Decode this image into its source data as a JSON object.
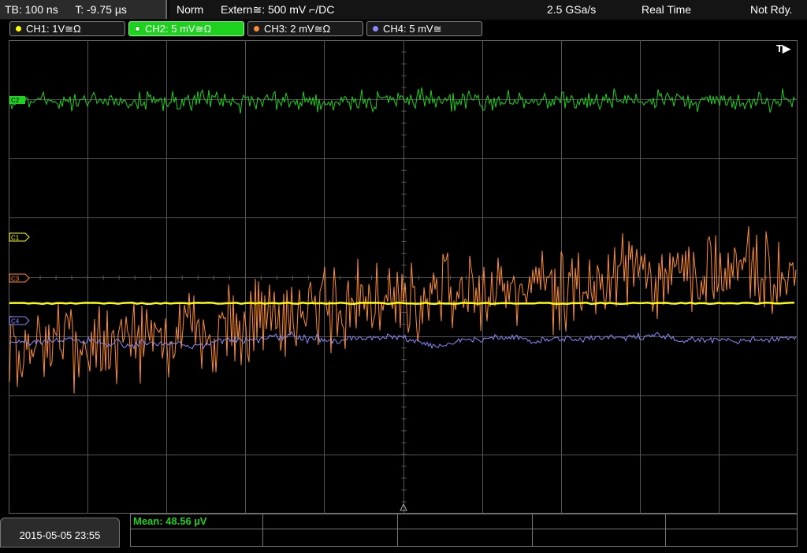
{
  "topbar": {
    "timebase": "TB: 100 ns",
    "trigger_time": "T: -9.75 µs",
    "mode": "Norm",
    "trigger": "Extern≅: 500 mV ⌐/DC",
    "sample_rate": "2.5 GSa/s",
    "acq_mode": "Real Time",
    "status": "Not Rdy."
  },
  "channels": [
    {
      "label": "CH1: 1V≅Ω",
      "color": "#ffff00"
    },
    {
      "label": "CH2: 5 mV≅Ω",
      "color": "#1fd11f"
    },
    {
      "label": "CH3: 2 mV≅Ω",
      "color": "#ff8c2e"
    },
    {
      "label": "CH4: 5 mV≅",
      "color": "#8a8aff"
    }
  ],
  "markers": {
    "ch2": "C2",
    "ch1": "C1",
    "ch3": "C3",
    "ch4": "C4",
    "trigger_pos": "T▶"
  },
  "bottom": {
    "datetime": "2015-05-05 23:55",
    "measurement": "Mean: 48.56 µV"
  },
  "colors": {
    "grid": "#555555",
    "ch1": "#ffff00",
    "ch2": "#1fd11f",
    "ch3": "#ff8c2e",
    "ch4": "#8a8aff"
  }
}
